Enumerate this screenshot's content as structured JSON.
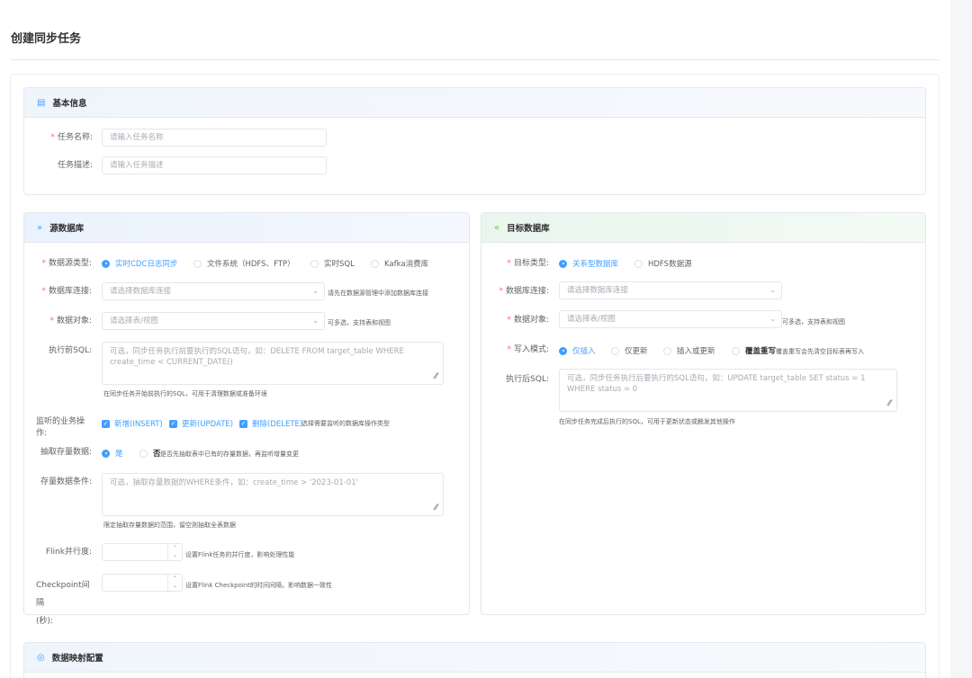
{
  "page": {
    "title": "创建同步任务"
  },
  "basic": {
    "title": "基本信息",
    "icon": "document-icon",
    "name_label": "任务名称:",
    "name_placeholder": "请输入任务名称",
    "desc_label": "任务描述:",
    "desc_placeholder": "请输入任务描述"
  },
  "source": {
    "title": "源数据库",
    "icon": "double-chevron-right-icon",
    "type_label": "数据源类型:",
    "type_options": [
      "实时CDC日志同步",
      "文件系统（HDFS、FTP）",
      "实时SQL",
      "Kafka消费库"
    ],
    "type_selected": 0,
    "conn_label": "数据库连接:",
    "conn_placeholder": "请选择数据库连接",
    "conn_hint": "请先在数据源管理中添加数据库连接",
    "obj_label": "数据对象:",
    "obj_placeholder": "请选择表/视图",
    "obj_hint": "可多选，支持表和视图",
    "pre_sql_label": "执行前SQL:",
    "pre_sql_placeholder": "可选，同步任务执行前要执行的SQL语句，如：DELETE FROM target_table WHERE create_time < CURRENT_DATE()",
    "pre_sql_hint": "在同步任务开始前执行的SQL，可用于清理数据或准备环境",
    "ops_label_1": "监听的业务操",
    "ops_label_2": "作:",
    "ops": [
      "新增(INSERT)",
      "更新(UPDATE)",
      "删除(DELETE)"
    ],
    "ops_hint": "选择需要监听的数据库操作类型",
    "extract_label": "抽取存量数据:",
    "extract_yes": "是",
    "extract_no": "否",
    "extract_hint": "是否先抽取表中已有的存量数据，再监听增量变更",
    "cond_label": "存量数据条件:",
    "cond_placeholder": "可选，抽取存量数据的WHERE条件，如：create_time > '2023-01-01'",
    "cond_hint": "限定抽取存量数据的范围，留空则抽取全表数据",
    "flink_label": "Flink并行度:",
    "flink_hint": "设置Flink任务的并行度，影响处理性能",
    "ckpt_label_1": "Checkpoint间隔",
    "ckpt_label_2": "(秒):",
    "ckpt_hint": "设置Flink Checkpoint的时间间隔，影响数据一致性"
  },
  "target": {
    "title": "目标数据库",
    "icon": "double-chevron-left-icon",
    "type_label": "目标类型:",
    "type_options": [
      "关系型数据库",
      "HDFS数据源"
    ],
    "type_selected": 0,
    "conn_label": "数据库连接:",
    "conn_placeholder": "请选择数据库连接",
    "obj_label": "数据对象:",
    "obj_placeholder": "请选择表/视图",
    "obj_hint": "可多选，支持表和视图",
    "mode_label": "写入模式:",
    "mode_options": [
      "仅插入",
      "仅更新",
      "插入或更新",
      "覆盖重写"
    ],
    "mode_selected": 0,
    "mode_hint": "覆盖重写会先清空目标表再写入",
    "post_sql_label": "执行后SQL:",
    "post_sql_placeholder": "可选，同步任务执行后要执行的SQL语句，如：UPDATE target_table SET status = 1 WHERE status = 0",
    "post_sql_hint": "在同步任务完成后执行的SQL，可用于更新状态或触发其他操作"
  },
  "mapping": {
    "title": "数据映射配置",
    "icon": "mapping-icon"
  },
  "colors": {
    "primary": "#409eff",
    "required": "#f56c6c",
    "green": "#67c23a"
  }
}
